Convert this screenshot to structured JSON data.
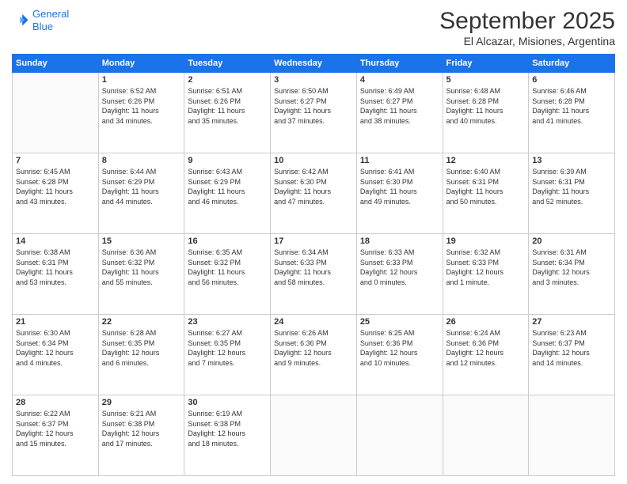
{
  "header": {
    "logo_line1": "General",
    "logo_line2": "Blue",
    "title": "September 2025",
    "subtitle": "El Alcazar, Misiones, Argentina"
  },
  "days_of_week": [
    "Sunday",
    "Monday",
    "Tuesday",
    "Wednesday",
    "Thursday",
    "Friday",
    "Saturday"
  ],
  "weeks": [
    [
      {
        "day": "",
        "info": ""
      },
      {
        "day": "1",
        "info": "Sunrise: 6:52 AM\nSunset: 6:26 PM\nDaylight: 11 hours\nand 34 minutes."
      },
      {
        "day": "2",
        "info": "Sunrise: 6:51 AM\nSunset: 6:26 PM\nDaylight: 11 hours\nand 35 minutes."
      },
      {
        "day": "3",
        "info": "Sunrise: 6:50 AM\nSunset: 6:27 PM\nDaylight: 11 hours\nand 37 minutes."
      },
      {
        "day": "4",
        "info": "Sunrise: 6:49 AM\nSunset: 6:27 PM\nDaylight: 11 hours\nand 38 minutes."
      },
      {
        "day": "5",
        "info": "Sunrise: 6:48 AM\nSunset: 6:28 PM\nDaylight: 11 hours\nand 40 minutes."
      },
      {
        "day": "6",
        "info": "Sunrise: 6:46 AM\nSunset: 6:28 PM\nDaylight: 11 hours\nand 41 minutes."
      }
    ],
    [
      {
        "day": "7",
        "info": "Sunrise: 6:45 AM\nSunset: 6:28 PM\nDaylight: 11 hours\nand 43 minutes."
      },
      {
        "day": "8",
        "info": "Sunrise: 6:44 AM\nSunset: 6:29 PM\nDaylight: 11 hours\nand 44 minutes."
      },
      {
        "day": "9",
        "info": "Sunrise: 6:43 AM\nSunset: 6:29 PM\nDaylight: 11 hours\nand 46 minutes."
      },
      {
        "day": "10",
        "info": "Sunrise: 6:42 AM\nSunset: 6:30 PM\nDaylight: 11 hours\nand 47 minutes."
      },
      {
        "day": "11",
        "info": "Sunrise: 6:41 AM\nSunset: 6:30 PM\nDaylight: 11 hours\nand 49 minutes."
      },
      {
        "day": "12",
        "info": "Sunrise: 6:40 AM\nSunset: 6:31 PM\nDaylight: 11 hours\nand 50 minutes."
      },
      {
        "day": "13",
        "info": "Sunrise: 6:39 AM\nSunset: 6:31 PM\nDaylight: 11 hours\nand 52 minutes."
      }
    ],
    [
      {
        "day": "14",
        "info": "Sunrise: 6:38 AM\nSunset: 6:31 PM\nDaylight: 11 hours\nand 53 minutes."
      },
      {
        "day": "15",
        "info": "Sunrise: 6:36 AM\nSunset: 6:32 PM\nDaylight: 11 hours\nand 55 minutes."
      },
      {
        "day": "16",
        "info": "Sunrise: 6:35 AM\nSunset: 6:32 PM\nDaylight: 11 hours\nand 56 minutes."
      },
      {
        "day": "17",
        "info": "Sunrise: 6:34 AM\nSunset: 6:33 PM\nDaylight: 11 hours\nand 58 minutes."
      },
      {
        "day": "18",
        "info": "Sunrise: 6:33 AM\nSunset: 6:33 PM\nDaylight: 12 hours\nand 0 minutes."
      },
      {
        "day": "19",
        "info": "Sunrise: 6:32 AM\nSunset: 6:33 PM\nDaylight: 12 hours\nand 1 minute."
      },
      {
        "day": "20",
        "info": "Sunrise: 6:31 AM\nSunset: 6:34 PM\nDaylight: 12 hours\nand 3 minutes."
      }
    ],
    [
      {
        "day": "21",
        "info": "Sunrise: 6:30 AM\nSunset: 6:34 PM\nDaylight: 12 hours\nand 4 minutes."
      },
      {
        "day": "22",
        "info": "Sunrise: 6:28 AM\nSunset: 6:35 PM\nDaylight: 12 hours\nand 6 minutes."
      },
      {
        "day": "23",
        "info": "Sunrise: 6:27 AM\nSunset: 6:35 PM\nDaylight: 12 hours\nand 7 minutes."
      },
      {
        "day": "24",
        "info": "Sunrise: 6:26 AM\nSunset: 6:36 PM\nDaylight: 12 hours\nand 9 minutes."
      },
      {
        "day": "25",
        "info": "Sunrise: 6:25 AM\nSunset: 6:36 PM\nDaylight: 12 hours\nand 10 minutes."
      },
      {
        "day": "26",
        "info": "Sunrise: 6:24 AM\nSunset: 6:36 PM\nDaylight: 12 hours\nand 12 minutes."
      },
      {
        "day": "27",
        "info": "Sunrise: 6:23 AM\nSunset: 6:37 PM\nDaylight: 12 hours\nand 14 minutes."
      }
    ],
    [
      {
        "day": "28",
        "info": "Sunrise: 6:22 AM\nSunset: 6:37 PM\nDaylight: 12 hours\nand 15 minutes."
      },
      {
        "day": "29",
        "info": "Sunrise: 6:21 AM\nSunset: 6:38 PM\nDaylight: 12 hours\nand 17 minutes."
      },
      {
        "day": "30",
        "info": "Sunrise: 6:19 AM\nSunset: 6:38 PM\nDaylight: 12 hours\nand 18 minutes."
      },
      {
        "day": "",
        "info": ""
      },
      {
        "day": "",
        "info": ""
      },
      {
        "day": "",
        "info": ""
      },
      {
        "day": "",
        "info": ""
      }
    ]
  ]
}
